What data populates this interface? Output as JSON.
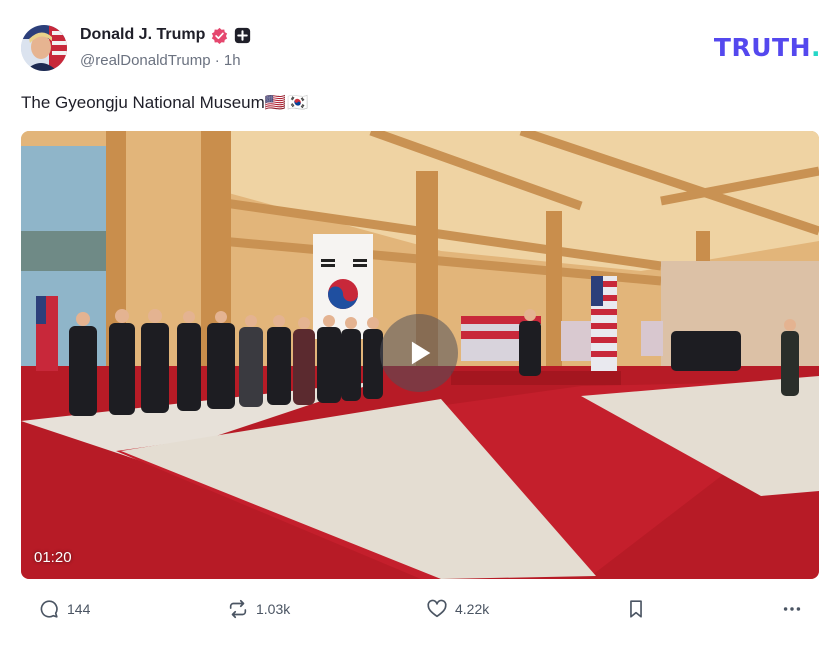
{
  "post": {
    "author": {
      "display_name": "Donald J. Trump",
      "handle": "@realDonaldTrump",
      "time": "1h",
      "separator": "·"
    },
    "text": "The Gyeongju National Museum",
    "flag_glyphs": "🇺🇸🇰🇷",
    "video": {
      "duration": "01:20"
    },
    "actions": {
      "replies": "144",
      "retruths": "1.03k",
      "likes": "4.22k"
    }
  },
  "brand": {
    "logo_text": "TRUTH",
    "logo_dot": ".",
    "colors": {
      "logo": "#5448ee",
      "logo_dot": "#25d7c7",
      "verified": "#e5476e"
    }
  },
  "icons": [
    "verified-badge-icon",
    "plus-badge-icon",
    "play-icon",
    "comment-icon",
    "retruth-icon",
    "heart-icon",
    "bookmark-icon",
    "more-icon"
  ]
}
